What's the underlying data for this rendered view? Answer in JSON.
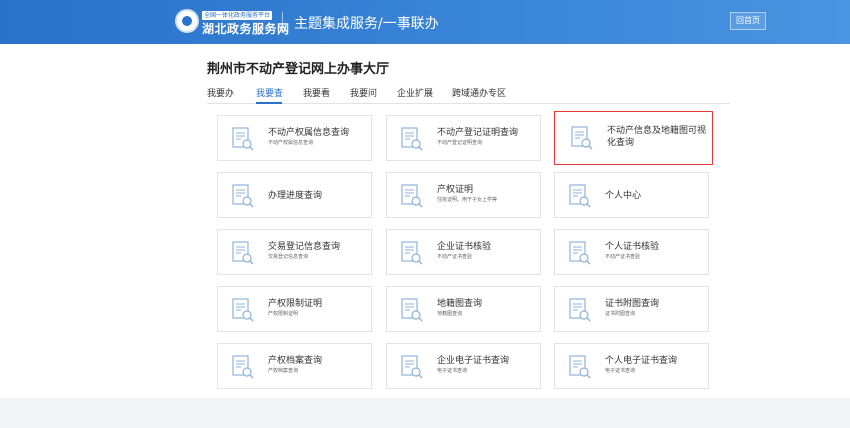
{
  "header": {
    "badge": "全国一体化政务服务平台",
    "brand": "湖北政务服务网",
    "title": "主题集成服务/一事联办",
    "home_button": "回首页"
  },
  "page_title": "荆州市不动产登记网上办事大厅",
  "tabs": [
    {
      "label": "我要办"
    },
    {
      "label": "我要查",
      "active": true
    },
    {
      "label": "我要看"
    },
    {
      "label": "我要问"
    },
    {
      "label": "企业扩展"
    },
    {
      "label": "跨域通办专区"
    }
  ],
  "cards": [
    {
      "title": "不动产权属信息查询",
      "sub": "不动产权属信息查询"
    },
    {
      "title": "不动产登记证明查询",
      "sub": "不动产登记证明查询"
    },
    {
      "title": "不动产信息及地籍图可视化查询",
      "sub": "",
      "selected": true
    },
    {
      "title": "办理进度查询",
      "sub": ""
    },
    {
      "title": "产权证明",
      "sub": "住房证明、用于子女上学等"
    },
    {
      "title": "个人中心",
      "sub": ""
    },
    {
      "title": "交易登记信息查询",
      "sub": "交易登记信息查询"
    },
    {
      "title": "企业证书核验",
      "sub": "不动产证书查验"
    },
    {
      "title": "个人证书核验",
      "sub": "不动产证书查验"
    },
    {
      "title": "产权限制证明",
      "sub": "产权限制证明"
    },
    {
      "title": "地籍图查询",
      "sub": "地籍图查询"
    },
    {
      "title": "证书附图查询",
      "sub": "证书附图查询"
    },
    {
      "title": "产权档案查询",
      "sub": "产权档案查询"
    },
    {
      "title": "企业电子证书查询",
      "sub": "电子证书查询"
    },
    {
      "title": "个人电子证书查询",
      "sub": "电子证书查询"
    }
  ],
  "colors": {
    "header": "#2a72c9",
    "accent": "#2a72c9",
    "selected_border": "#e33a3a",
    "icon": "#8fb3d9"
  },
  "icons": {
    "card_icon": "document-search-icon",
    "logo": "government-emblem-icon"
  }
}
